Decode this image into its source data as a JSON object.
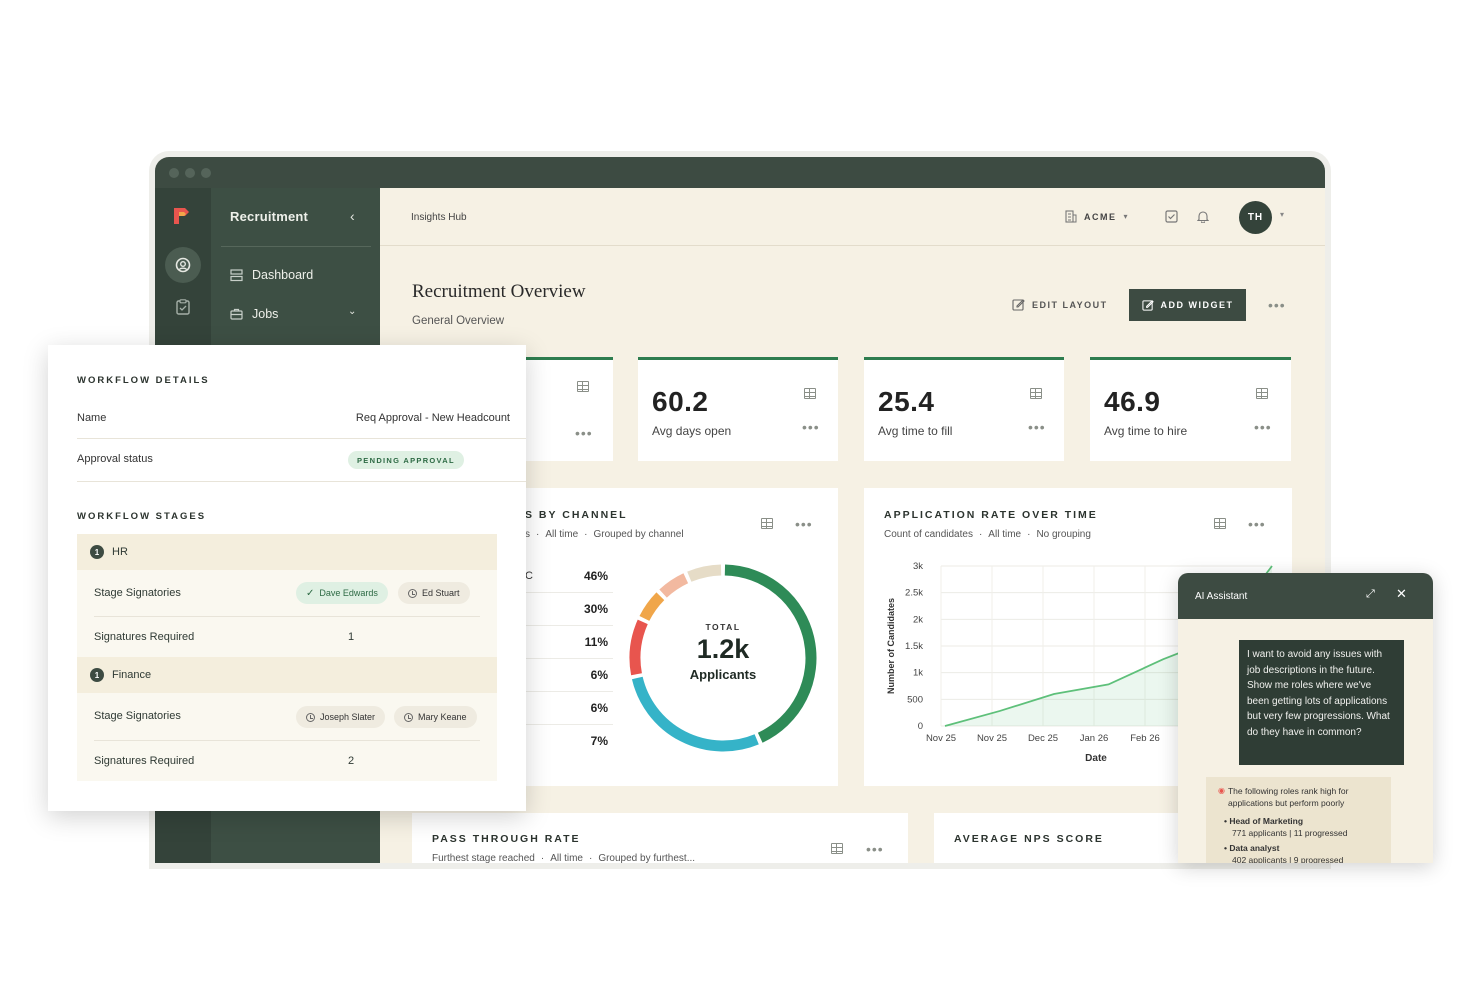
{
  "nav": {
    "title": "Recruitment",
    "items": [
      {
        "label": "Dashboard"
      },
      {
        "label": "Jobs"
      }
    ]
  },
  "topbar": {
    "breadcrumb": "Insights Hub",
    "org": "ACME",
    "avatar_initials": "TH"
  },
  "page": {
    "title": "Recruitment Overview",
    "subtitle": "General Overview",
    "edit_layout": "EDIT LAYOUT",
    "add_widget": "ADD WIDGET"
  },
  "kpis": [
    {
      "value": "60.2",
      "label": "Avg days open"
    },
    {
      "value": "25.4",
      "label": "Avg time to fill"
    },
    {
      "value": "46.9",
      "label": "Avg time to hire"
    }
  ],
  "channel_card": {
    "title": "S BY CHANNEL",
    "sub_lead": "s",
    "sub_time": "All time",
    "sub_group": "Grouped by channel",
    "row_lead": "C",
    "percents": [
      "46%",
      "30%",
      "11%",
      "6%",
      "6%",
      "7%"
    ],
    "donut_total_label": "TOTAL",
    "donut_total_value": "1.2k",
    "donut_total_unit": "Applicants"
  },
  "rate_card": {
    "title": "APPLICATION RATE OVER TIME",
    "sub_count": "Count of candidates",
    "sub_time": "All time",
    "sub_group": "No grouping"
  },
  "pass_card": {
    "title": "PASS THROUGH RATE",
    "sub_reached": "Furthest stage reached",
    "sub_time": "All time",
    "sub_group": "Grouped by furthest..."
  },
  "nps_card": {
    "title": "AVERAGE NPS SCORE"
  },
  "workflow": {
    "details_title": "WORKFLOW DETAILS",
    "name_label": "Name",
    "name_value": "Req Approval - New Headcount",
    "status_label": "Approval status",
    "status_value": "PENDING APPROVAL",
    "stages_title": "WORKFLOW STAGES",
    "stages": [
      {
        "num": "1",
        "name": "HR",
        "signatories_label": "Stage Signatories",
        "signatories": [
          "Dave Edwards",
          "Ed Stuart"
        ],
        "required_label": "Signatures Required",
        "required": "1"
      },
      {
        "num": "1",
        "name": "Finance",
        "signatories_label": "Stage Signatories",
        "signatories": [
          "Joseph Slater",
          "Mary Keane"
        ],
        "required_label": "Signatures Required",
        "required": "2"
      }
    ]
  },
  "ai": {
    "title": "AI Assistant",
    "user_message": "I want to avoid any issues with job descriptions in the future. Show me roles where we've been getting lots of applications but very few progressions. What do they have in common?",
    "reply_intro": "The following roles rank high for applications but perform poorly",
    "reply_items": [
      {
        "role": "Head of Marketing",
        "detail": "771 applicants | 11 progressed"
      },
      {
        "role": "Data analyst",
        "detail": "402 applicants | 9 progressed"
      }
    ]
  },
  "chart_data": [
    {
      "type": "pie",
      "title": "",
      "categories": [],
      "values": [
        46,
        30,
        11,
        6,
        6,
        7
      ],
      "total_label": "1.2k",
      "colors": [
        "#2e8b57",
        "#35b3c8",
        "#e8554e",
        "#f0a64a",
        "#f2b9a0",
        "#e6dcc7"
      ]
    },
    {
      "type": "line",
      "title": "APPLICATION RATE OVER TIME",
      "xlabel": "Date",
      "ylabel": "Number of Candidates",
      "x": [
        "Nov 25",
        "Nov 25",
        "Dec 25",
        "Jan 26",
        "Feb 26"
      ],
      "values": [
        0,
        280,
        600,
        780,
        1250,
        1650,
        3000
      ],
      "ylim": [
        0,
        3000
      ],
      "yticks": [
        "0",
        "500",
        "1k",
        "1.5k",
        "2k",
        "2.5k",
        "3k"
      ],
      "color": "#5ec07a",
      "grid": true
    }
  ]
}
